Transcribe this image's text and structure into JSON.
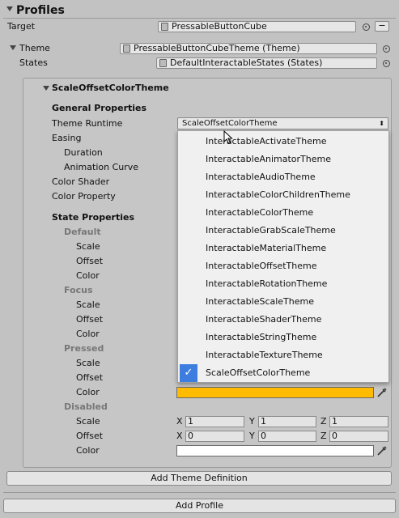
{
  "header": {
    "title": "Profiles"
  },
  "target": {
    "label": "Target",
    "value": "PressableButtonCube",
    "minus": "−"
  },
  "theme": {
    "label": "Theme",
    "value": "PressableButtonCubeTheme (Theme)"
  },
  "states": {
    "label": "States",
    "value": "DefaultInteractableStates (States)"
  },
  "section": {
    "title": "ScaleOffsetColorTheme",
    "general_title": "General Properties",
    "theme_runtime_label": "Theme Runtime",
    "theme_runtime_value": "ScaleOffsetColorTheme",
    "easing_label": "Easing",
    "duration_label": "Duration",
    "animation_curve_label": "Animation Curve",
    "color_shader_label": "Color Shader",
    "color_property_label": "Color Property",
    "state_properties_title": "State Properties"
  },
  "states_list": [
    {
      "name": "Default",
      "scale": "Scale",
      "offset": "Offset",
      "color": "Color"
    },
    {
      "name": "Focus",
      "scale": "Scale",
      "offset": "Offset",
      "color": "Color"
    },
    {
      "name": "Pressed",
      "scale": "Scale",
      "offset": "Offset",
      "color": "Color",
      "color_value": "#ffbb00"
    },
    {
      "name": "Disabled",
      "scale": "Scale",
      "offset": "Offset",
      "color": "Color",
      "color_value": "#ffffff",
      "scale_xyz": {
        "x_label": "X",
        "x": "1",
        "y_label": "Y",
        "y": "1",
        "z_label": "Z",
        "z": "1"
      },
      "offset_xyz": {
        "x_label": "X",
        "x": "0",
        "y_label": "Y",
        "y": "0",
        "z_label": "Z",
        "z": "0"
      }
    }
  ],
  "dropdown": {
    "items": [
      "InteractableActivateTheme",
      "InteractableAnimatorTheme",
      "InteractableAudioTheme",
      "InteractableColorChildrenTheme",
      "InteractableColorTheme",
      "InteractableGrabScaleTheme",
      "InteractableMaterialTheme",
      "InteractableOffsetTheme",
      "InteractableRotationTheme",
      "InteractableScaleTheme",
      "InteractableShaderTheme",
      "InteractableStringTheme",
      "InteractableTextureTheme",
      "ScaleOffsetColorTheme"
    ],
    "selected": "ScaleOffsetColorTheme",
    "check": "✓"
  },
  "buttons": {
    "add_theme_definition": "Add Theme Definition",
    "add_profile": "Add Profile"
  },
  "icons": {
    "select_arrow": "⬍",
    "foldout": "triangle-down-icon"
  }
}
